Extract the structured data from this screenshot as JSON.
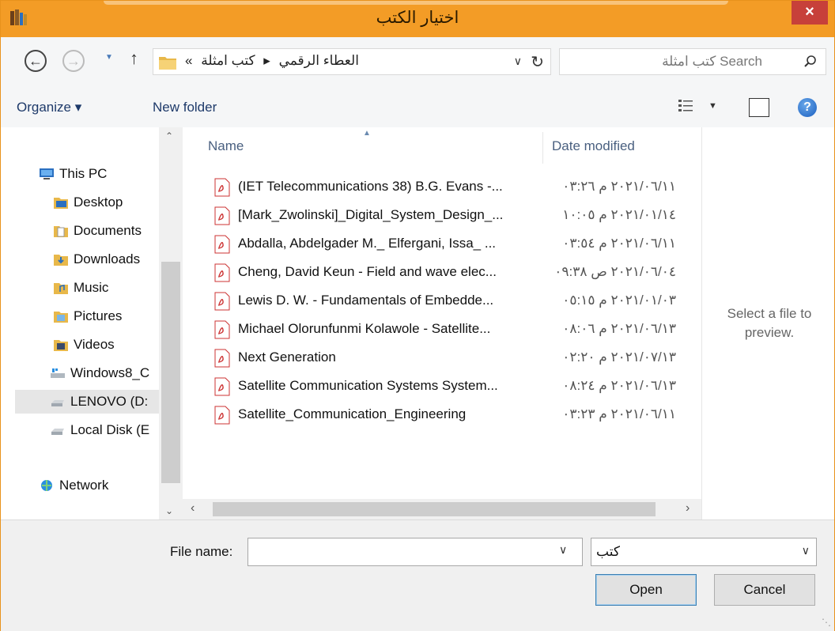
{
  "window": {
    "title": "اختيار الكتب",
    "close_label": "×"
  },
  "address": {
    "crumbs": [
      "«",
      "العطاء الرقمي",
      "▸",
      "كتب امثلة"
    ],
    "search_placeholder": "كتب امثلة Search"
  },
  "toolbar": {
    "organize_label": "Organize ▾",
    "new_folder_label": "New folder"
  },
  "nav": {
    "items": [
      {
        "label": "This PC",
        "icon": "computer-icon"
      },
      {
        "label": "Desktop",
        "icon": "folder-icon"
      },
      {
        "label": "Documents",
        "icon": "documents-icon"
      },
      {
        "label": "Downloads",
        "icon": "downloads-icon"
      },
      {
        "label": "Music",
        "icon": "music-icon"
      },
      {
        "label": "Pictures",
        "icon": "pictures-icon"
      },
      {
        "label": "Videos",
        "icon": "videos-icon"
      },
      {
        "label": "Windows8_C",
        "icon": "windows-drive-icon"
      },
      {
        "label": "LENOVO (D:",
        "icon": "drive-icon"
      },
      {
        "label": "Local Disk (E",
        "icon": "drive-icon"
      },
      {
        "label": "Network",
        "icon": "network-icon"
      }
    ]
  },
  "columns": {
    "name": "Name",
    "date": "Date modified"
  },
  "files": [
    {
      "name": "(IET Telecommunications 38) B.G. Evans -...",
      "date": "٢٠٢١/٠٦/١١ م ٠٣:٢٦"
    },
    {
      "name": "[Mark_Zwolinski]_Digital_System_Design_...",
      "date": "٢٠٢١/٠١/١٤ م ١٠:٠٥"
    },
    {
      "name": "Abdalla, Abdelgader M._ Elfergani, Issa_ ...",
      "date": "٢٠٢١/٠٦/١١ م ٠٣:٥٤"
    },
    {
      "name": "Cheng, David Keun - Field and wave elec...",
      "date": "٢٠٢١/٠٦/٠٤ ص ٠٩:٣٨"
    },
    {
      "name": "Lewis D. W. - Fundamentals of Embedde...",
      "date": "٢٠٢١/٠١/٠٣ م ٠٥:١٥"
    },
    {
      "name": "Michael Olorunfunmi Kolawole - Satellite...",
      "date": "٢٠٢١/٠٦/١٣ م ٠٨:٠٦"
    },
    {
      "name": "Next Generation",
      "date": "٢٠٢١/٠٧/١٣ م ٠٢:٢٠"
    },
    {
      "name": "Satellite Communication Systems System...",
      "date": "٢٠٢١/٠٦/١٣ م ٠٨:٢٤"
    },
    {
      "name": "Satellite_Communication_Engineering",
      "date": "٢٠٢١/٠٦/١١ م ٠٣:٢٣"
    }
  ],
  "preview": {
    "text": "Select a file to preview."
  },
  "bottom": {
    "file_name_label": "File name:",
    "file_name_value": "",
    "file_type_value": "كتب",
    "open_label": "Open",
    "cancel_label": "Cancel"
  },
  "colors": {
    "titlebar": "#f39c26",
    "close": "#c7403a"
  }
}
